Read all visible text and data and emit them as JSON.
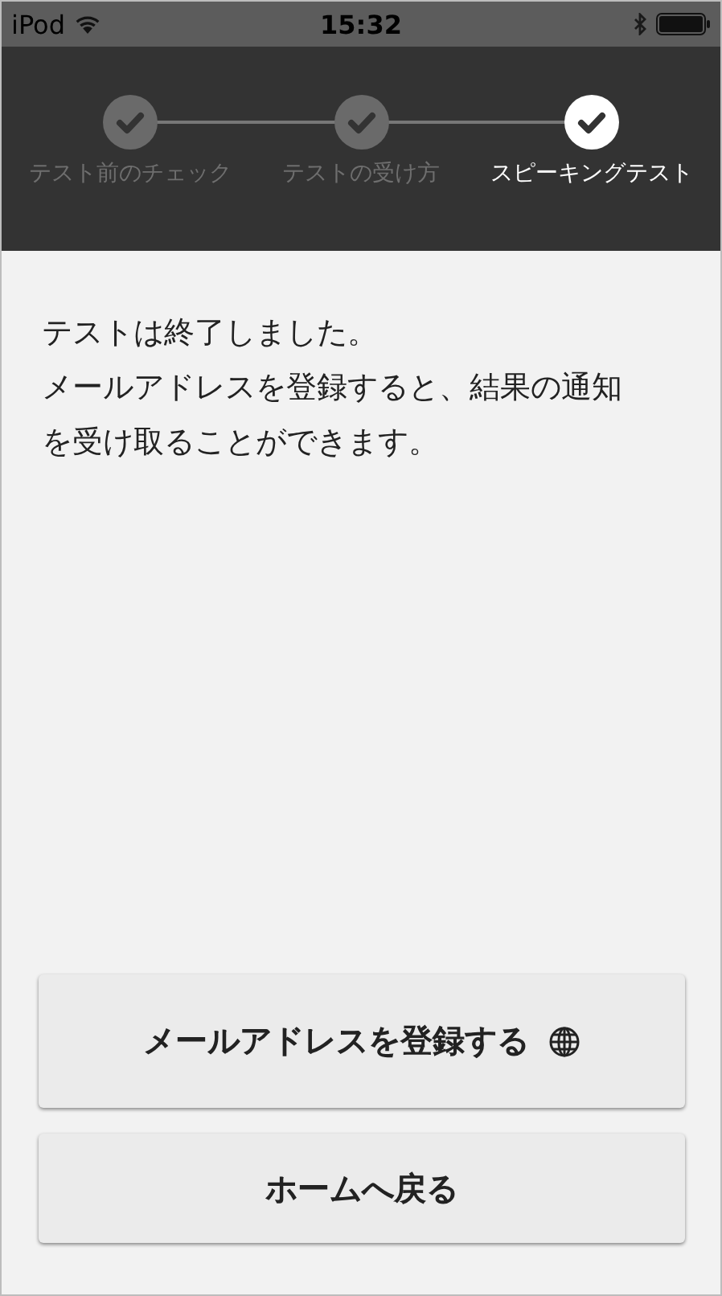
{
  "status_bar": {
    "carrier": "iPod",
    "time": "15:32"
  },
  "steps": [
    {
      "label": "テスト前のチェック",
      "selected": false
    },
    {
      "label": "テストの受け方",
      "selected": false
    },
    {
      "label": "スピーキングテスト",
      "selected": true
    }
  ],
  "message": [
    "テストは終了しました。",
    "メールアドレスを登録すると、結果の通知を受け取ることができます。"
  ],
  "buttons": [
    {
      "label": "メールアドレスを登録する",
      "kind": "globe"
    },
    {
      "label": "ホームへ戻る",
      "kind": "plain"
    }
  ]
}
